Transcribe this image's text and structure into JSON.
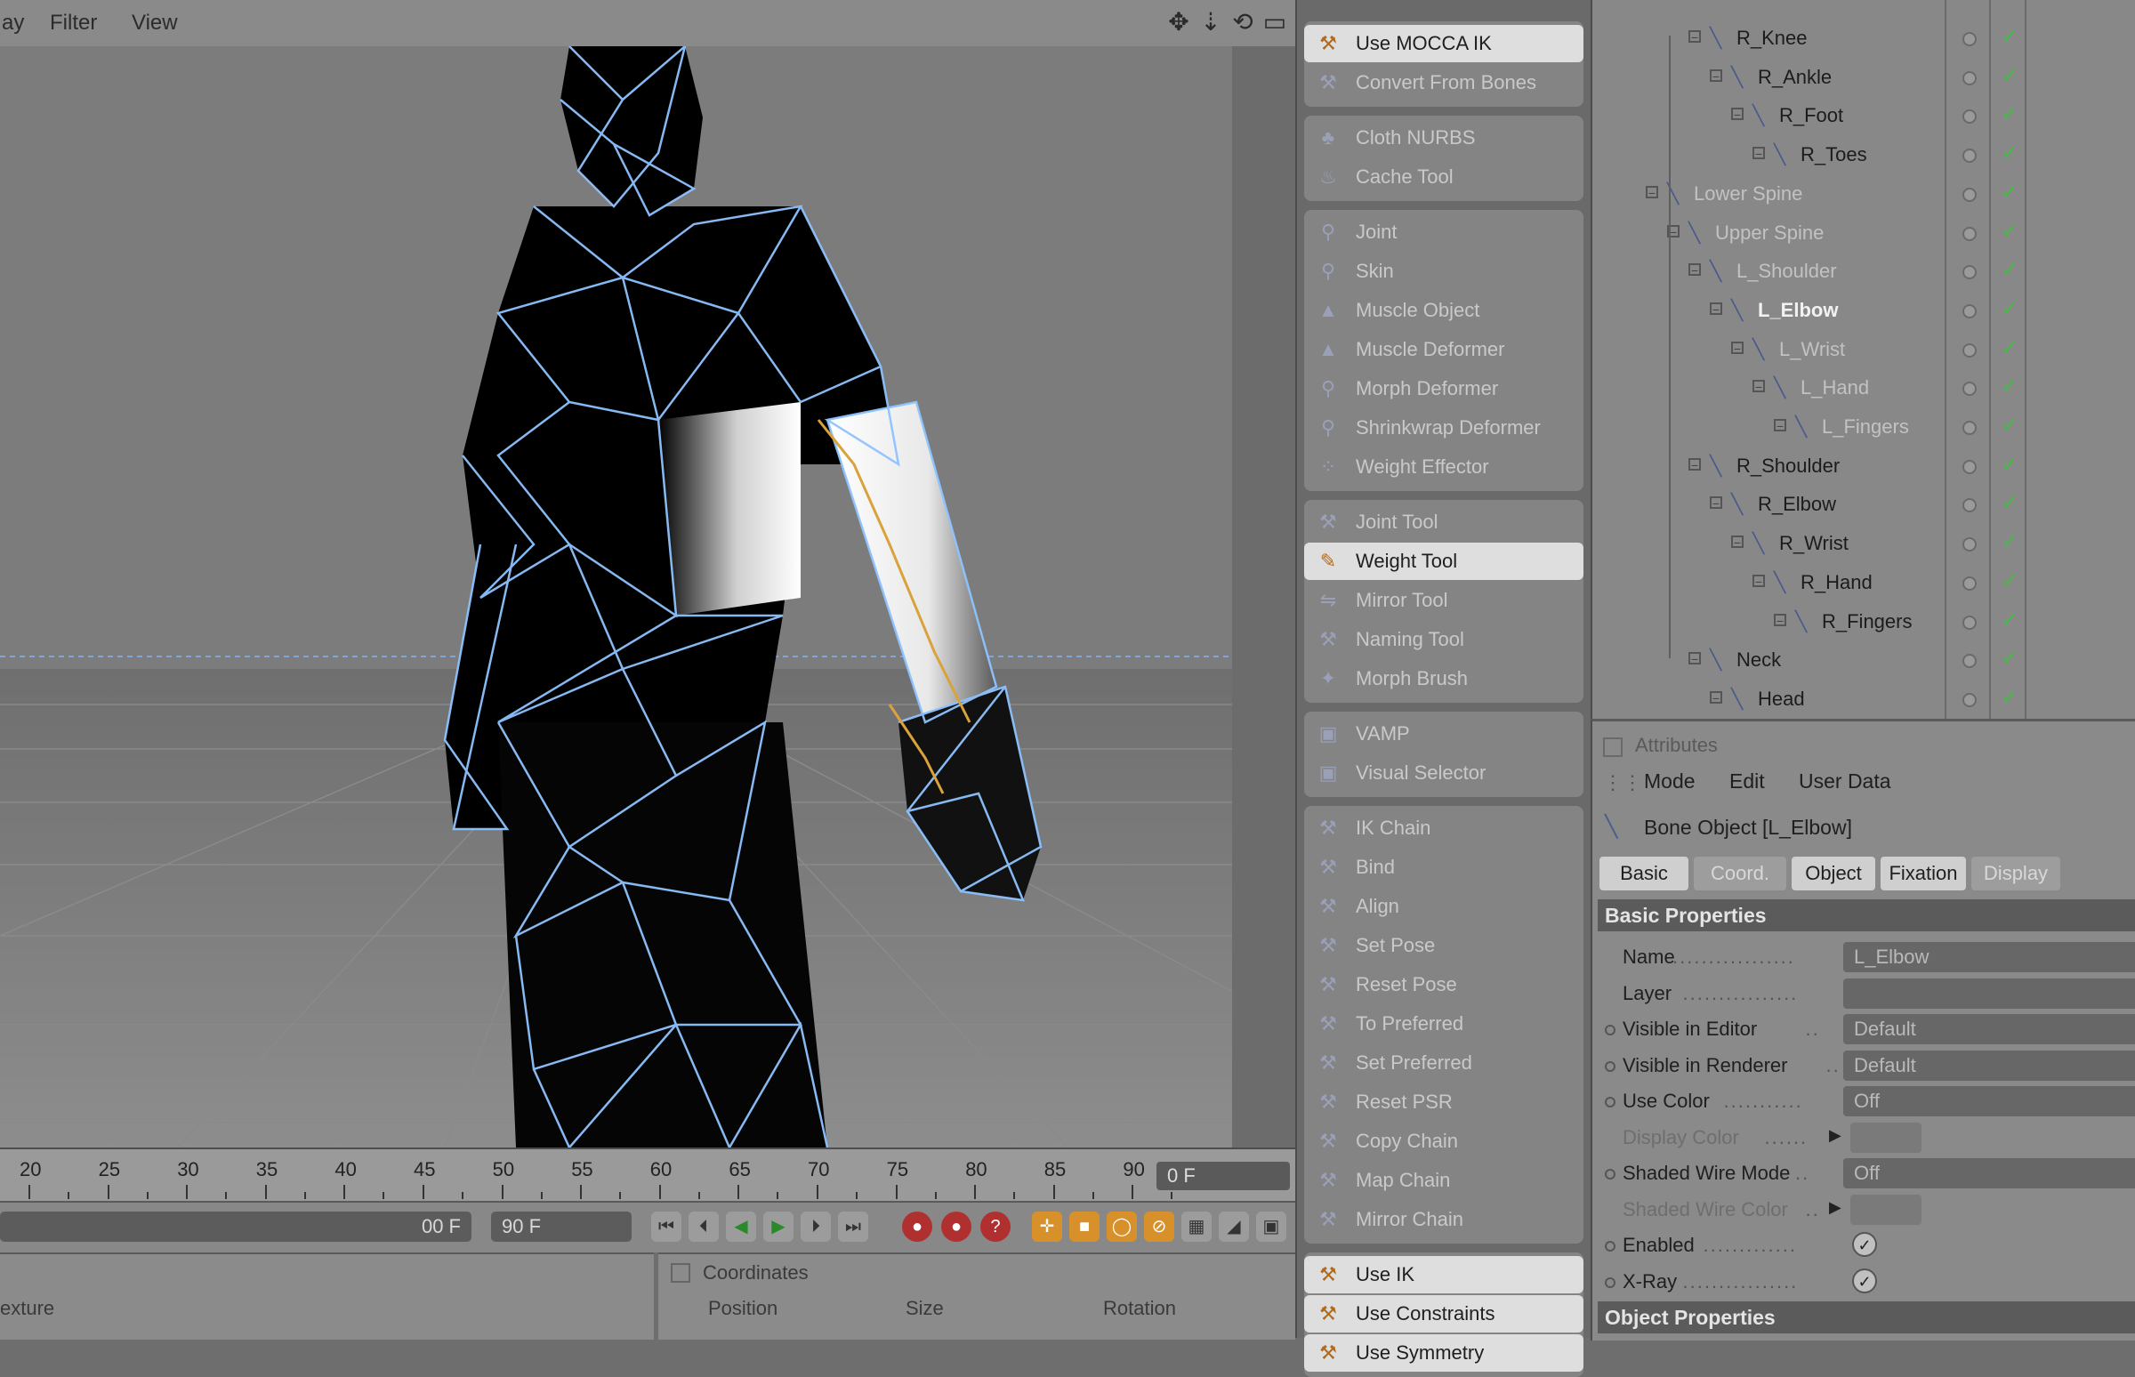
{
  "viewport": {
    "menu": [
      "ay",
      "Filter",
      "View"
    ],
    "icons": [
      "move-view-icon",
      "dolly-view-icon",
      "rotate-view-icon",
      "maximize-view-icon"
    ]
  },
  "timeline": {
    "ticks": [
      "20",
      "25",
      "30",
      "35",
      "40",
      "45",
      "50",
      "55",
      "60",
      "65",
      "70",
      "75",
      "80",
      "85",
      "90"
    ],
    "current_frame": "0 F"
  },
  "transport": {
    "min_field": "00 F",
    "max_field": "90 F"
  },
  "bottom": {
    "left_label": "exture",
    "coordinates_title": "Coordinates",
    "col_position": "Position",
    "col_size": "Size",
    "col_rotation": "Rotation"
  },
  "palette": {
    "groups": [
      [
        "Use MOCCA IK",
        "Convert From Bones"
      ],
      [
        "Cloth NURBS",
        "Cache Tool"
      ],
      [
        "Joint",
        "Skin",
        "Muscle Object",
        "Muscle Deformer",
        "Morph Deformer",
        "Shrinkwrap Deformer",
        "Weight Effector"
      ],
      [
        "Joint Tool",
        "Weight Tool",
        "Mirror Tool",
        "Naming Tool",
        "Morph Brush"
      ],
      [
        "VAMP",
        "Visual Selector"
      ],
      [
        "IK Chain",
        "Bind",
        "Align",
        "Set Pose",
        "Reset Pose",
        "To Preferred",
        "Set Preferred",
        "Reset PSR",
        "Copy Chain",
        "Map Chain",
        "Mirror Chain"
      ],
      [
        "Use IK",
        "Use Constraints",
        "Use Symmetry"
      ]
    ],
    "active": [
      "Use MOCCA IK",
      "Weight Tool",
      "Use IK",
      "Use Constraints",
      "Use Symmetry"
    ]
  },
  "objects": [
    {
      "label": "R_Knee",
      "indent": 3,
      "style": "normal"
    },
    {
      "label": "R_Ankle",
      "indent": 4,
      "style": "normal"
    },
    {
      "label": "R_Foot",
      "indent": 5,
      "style": "normal"
    },
    {
      "label": "R_Toes",
      "indent": 6,
      "style": "normal"
    },
    {
      "label": "Lower Spine",
      "indent": 1,
      "style": "faded"
    },
    {
      "label": "Upper Spine",
      "indent": 2,
      "style": "faded"
    },
    {
      "label": "L_Shoulder",
      "indent": 3,
      "style": "faded"
    },
    {
      "label": "L_Elbow",
      "indent": 4,
      "style": "hl"
    },
    {
      "label": "L_Wrist",
      "indent": 5,
      "style": "faded"
    },
    {
      "label": "L_Hand",
      "indent": 6,
      "style": "faded"
    },
    {
      "label": "L_Fingers",
      "indent": 7,
      "style": "faded"
    },
    {
      "label": "R_Shoulder",
      "indent": 3,
      "style": "normal"
    },
    {
      "label": "R_Elbow",
      "indent": 4,
      "style": "normal"
    },
    {
      "label": "R_Wrist",
      "indent": 5,
      "style": "normal"
    },
    {
      "label": "R_Hand",
      "indent": 6,
      "style": "normal"
    },
    {
      "label": "R_Fingers",
      "indent": 7,
      "style": "normal"
    },
    {
      "label": "Neck",
      "indent": 3,
      "style": "normal"
    },
    {
      "label": "Head",
      "indent": 4,
      "style": "normal"
    }
  ],
  "attributes": {
    "title": "Attributes",
    "menu": [
      "Mode",
      "Edit",
      "User Data"
    ],
    "object_title": "Bone Object [L_Elbow]",
    "tabs": [
      "Basic",
      "Coord.",
      "Object",
      "Fixation",
      "Display"
    ],
    "active_tabs": [
      "Basic",
      "Object",
      "Fixation"
    ],
    "basic_properties": "Basic Properties",
    "object_properties": "Object Properties",
    "rows": [
      {
        "label": "Name",
        "value": "L_Elbow",
        "type": "text",
        "dim": false
      },
      {
        "label": "Layer",
        "value": "",
        "type": "text",
        "dim": false
      },
      {
        "label": "Visible in Editor",
        "value": "Default",
        "type": "select",
        "dim": false
      },
      {
        "label": "Visible in Renderer",
        "value": "Default",
        "type": "select",
        "dim": false
      },
      {
        "label": "Use Color",
        "value": "Off",
        "type": "select",
        "dim": false
      },
      {
        "label": "Display Color",
        "value": "",
        "type": "color",
        "dim": true
      },
      {
        "label": "Shaded Wire Mode",
        "value": "Off",
        "type": "select",
        "dim": false
      },
      {
        "label": "Shaded Wire Color",
        "value": "",
        "type": "color",
        "dim": true
      },
      {
        "label": "Enabled",
        "value": "✓",
        "type": "check",
        "dim": false
      },
      {
        "label": "X-Ray",
        "value": "✓",
        "type": "check",
        "dim": false
      }
    ]
  },
  "colors": {
    "wire": "#7fb7ff",
    "accent_active_tool": "#dedede",
    "joint_orange": "#d9a23a"
  }
}
